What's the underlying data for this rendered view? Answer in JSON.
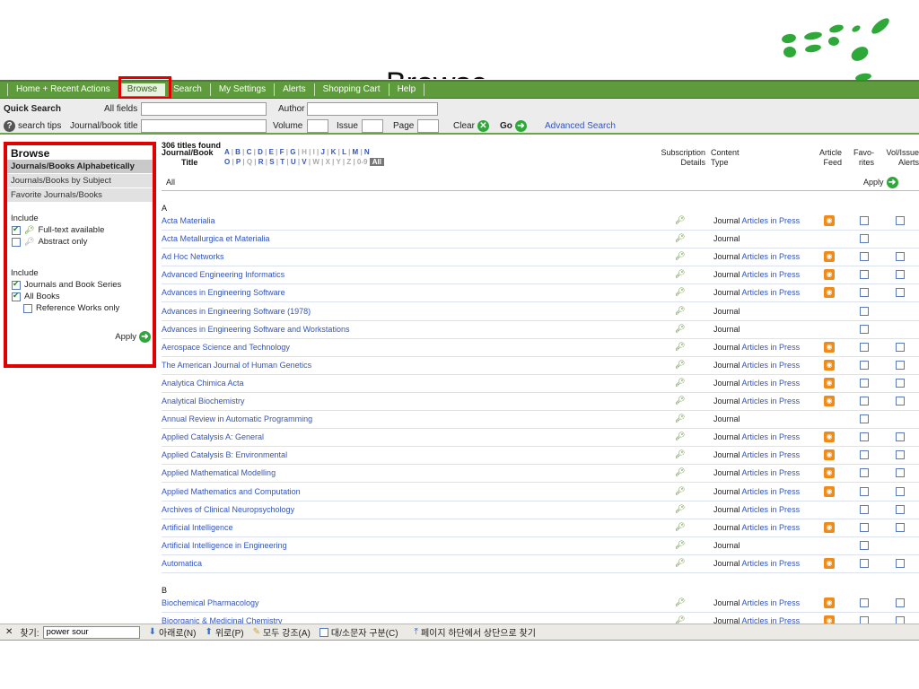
{
  "slide_title": "Browse",
  "nav": {
    "tabs": [
      "Home + Recent Actions",
      "Browse",
      "Search",
      "My Settings",
      "Alerts",
      "Shopping Cart",
      "Help"
    ],
    "active": "Browse"
  },
  "quick_search": {
    "label": "Quick Search",
    "all_fields": "All fields",
    "author": "Author",
    "search_tips": "search tips",
    "journal_title": "Journal/book title",
    "volume": "Volume",
    "issue": "Issue",
    "page": "Page",
    "clear": "Clear",
    "go": "Go",
    "advanced": "Advanced Search"
  },
  "sidebar": {
    "title": "Browse",
    "items": [
      "Journals/Books Alphabetically",
      "Journals/Books by Subject",
      "Favorite Journals/Books"
    ],
    "include1_label": "Include",
    "include1": [
      "Full-text available",
      "Abstract only"
    ],
    "include2_label": "Include",
    "include2": [
      "Journals and Book Series",
      "All Books",
      "Reference Works only"
    ],
    "apply": "Apply"
  },
  "list": {
    "count": "306 titles found",
    "journal_book": "Journal/Book",
    "title_label": "Title",
    "letters_row1": [
      "A",
      "B",
      "C",
      "D",
      "E",
      "F",
      "G",
      "H",
      "I",
      "J",
      "K",
      "L",
      "M",
      "N"
    ],
    "letters_row2": [
      "O",
      "P",
      "Q",
      "R",
      "S",
      "T",
      "U",
      "V",
      "W",
      "X",
      "Y",
      "Z",
      "0-9"
    ],
    "all_btn": "All",
    "col_subscription": "Subscription Details",
    "col_content": "Content Type",
    "col_article_feed": "Article Feed",
    "col_favorites": "Favo- rites",
    "col_alerts": "Vol/Issue Alerts",
    "all_text": "All",
    "apply": "Apply",
    "section_a": "A",
    "section_b": "B",
    "rows_a": [
      {
        "title": "Acta Materialia",
        "type": "Journal",
        "aip": "Articles in Press",
        "rss": true,
        "alert": true
      },
      {
        "title": "Acta Metallurgica et Materialia",
        "type": "Journal",
        "aip": "",
        "rss": false,
        "alert": false
      },
      {
        "title": "Ad Hoc Networks",
        "type": "Journal",
        "aip": "Articles in Press",
        "rss": true,
        "alert": true
      },
      {
        "title": "Advanced Engineering Informatics",
        "type": "Journal",
        "aip": "Articles in Press",
        "rss": true,
        "alert": true
      },
      {
        "title": "Advances in Engineering Software",
        "type": "Journal",
        "aip": "Articles in Press",
        "rss": true,
        "alert": true
      },
      {
        "title": "Advances in Engineering Software (1978)",
        "type": "Journal",
        "aip": "",
        "rss": false,
        "alert": false
      },
      {
        "title": "Advances in Engineering Software and Workstations",
        "type": "Journal",
        "aip": "",
        "rss": false,
        "alert": false
      },
      {
        "title": "Aerospace Science and Technology",
        "type": "Journal",
        "aip": "Articles in Press",
        "rss": true,
        "alert": true
      },
      {
        "title": "The American Journal of Human Genetics",
        "type": "Journal",
        "aip": "Articles in Press",
        "rss": true,
        "alert": true
      },
      {
        "title": "Analytica Chimica Acta",
        "type": "Journal",
        "aip": "Articles in Press",
        "rss": true,
        "alert": true
      },
      {
        "title": "Analytical Biochemistry",
        "type": "Journal",
        "aip": "Articles in Press",
        "rss": true,
        "alert": true
      },
      {
        "title": "Annual Review in Automatic Programming",
        "type": "Journal",
        "aip": "",
        "rss": false,
        "alert": false
      },
      {
        "title": "Applied Catalysis A: General",
        "type": "Journal",
        "aip": "Articles in Press",
        "rss": true,
        "alert": true
      },
      {
        "title": "Applied Catalysis B: Environmental",
        "type": "Journal",
        "aip": "Articles in Press",
        "rss": true,
        "alert": true
      },
      {
        "title": "Applied Mathematical Modelling",
        "type": "Journal",
        "aip": "Articles in Press",
        "rss": true,
        "alert": true
      },
      {
        "title": "Applied Mathematics and Computation",
        "type": "Journal",
        "aip": "Articles in Press",
        "rss": true,
        "alert": true
      },
      {
        "title": "Archives of Clinical Neuropsychology",
        "type": "Journal",
        "aip": "Articles in Press",
        "rss": false,
        "alert": true
      },
      {
        "title": "Artificial Intelligence",
        "type": "Journal",
        "aip": "Articles in Press",
        "rss": true,
        "alert": true
      },
      {
        "title": "Artificial Intelligence in Engineering",
        "type": "Journal",
        "aip": "",
        "rss": false,
        "alert": false
      },
      {
        "title": "Automatica",
        "type": "Journal",
        "aip": "Articles in Press",
        "rss": true,
        "alert": true
      }
    ],
    "rows_b": [
      {
        "title": "Biochemical Pharmacology",
        "type": "Journal",
        "aip": "Articles in Press",
        "rss": true,
        "alert": true
      },
      {
        "title": "Bioorganic & Medicinal Chemistry",
        "type": "Journal",
        "aip": "Articles in Press",
        "rss": true,
        "alert": true
      }
    ]
  },
  "findbar": {
    "label": "찾기:",
    "value": "power sour",
    "down": "아래로(N)",
    "up": "위로(P)",
    "highlight": "모두 강조(A)",
    "match_case": "대/소문자 구분(C)",
    "status": "페이지 하단에서 상단으로 찾기"
  },
  "colors": {
    "nav_green": "#5d9b3c",
    "link_blue": "#3355bb",
    "highlight_red": "#e00000",
    "rss_orange": "#f08a18",
    "logo_green": "#2fa83a"
  }
}
